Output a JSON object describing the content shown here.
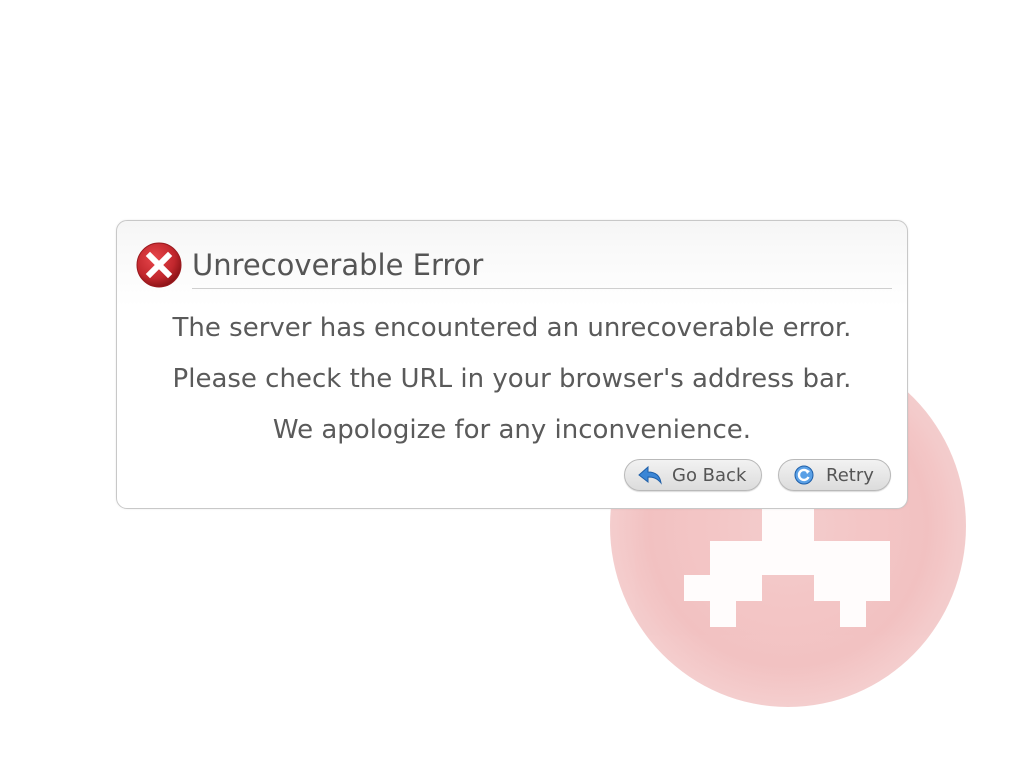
{
  "dialog": {
    "title": "Unrecoverable Error",
    "messages": [
      "The server has encountered an unrecoverable error.",
      "Please check the URL in your browser's address bar.",
      "We apologize for any inconvenience."
    ],
    "buttons": {
      "go_back": "Go Back",
      "retry": "Retry"
    }
  },
  "icons": {
    "dialog": "error-x-icon",
    "background": "error-x-icon",
    "go_back": "back-arrow-icon",
    "retry": "refresh-icon"
  },
  "colors": {
    "error_red": "#c1272d",
    "background_icon": "#f0b7b7",
    "text": "#555555",
    "button_icon": "#3b86d6"
  }
}
